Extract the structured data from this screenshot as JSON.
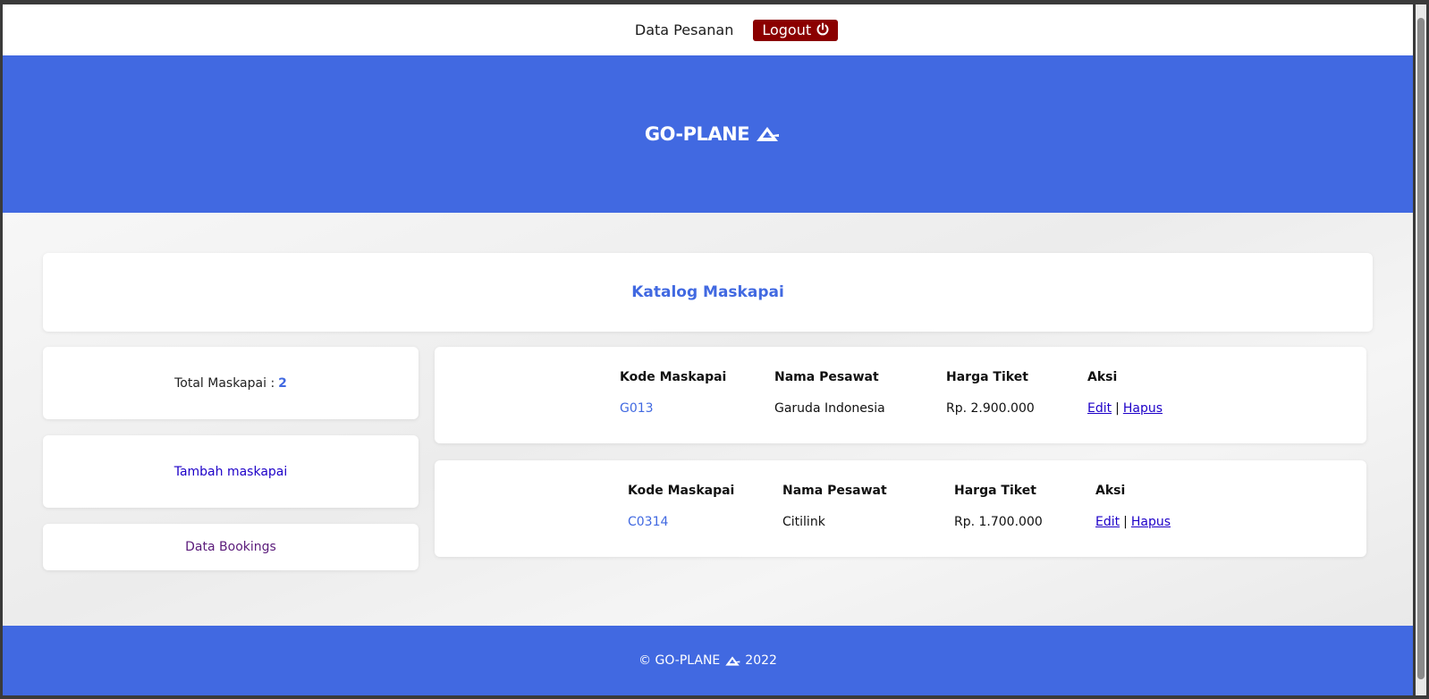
{
  "topbar": {
    "nav_link": "Data Pesanan",
    "logout_label": "Logout",
    "logout_color": "#8b0000"
  },
  "hero": {
    "logo_text": "GO-PLANE"
  },
  "main": {
    "title": "Katalog Maskapai",
    "total_label": "Total Maskapai :",
    "total_value": "2",
    "add_label": "Tambah maskapai",
    "bookings_label": "Data Bookings"
  },
  "table": {
    "headers": [
      "Kode Maskapai",
      "Nama Pesawat",
      "Harga Tiket",
      "Aksi"
    ],
    "rows": [
      {
        "code": "G013",
        "name": "Garuda Indonesia",
        "price": "Rp. 2.900.000",
        "edit": "Edit",
        "sep": "|",
        "delete": "Hapus"
      },
      {
        "code": "C0314",
        "name": "Citilink",
        "price": "Rp. 1.700.000",
        "edit": "Edit",
        "sep": "|",
        "delete": "Hapus"
      }
    ]
  },
  "footer": {
    "prefix": "© GO-PLANE",
    "year": "2022"
  },
  "colors": {
    "primary": "#4169e1",
    "page_bg": "#f3f3f3"
  }
}
